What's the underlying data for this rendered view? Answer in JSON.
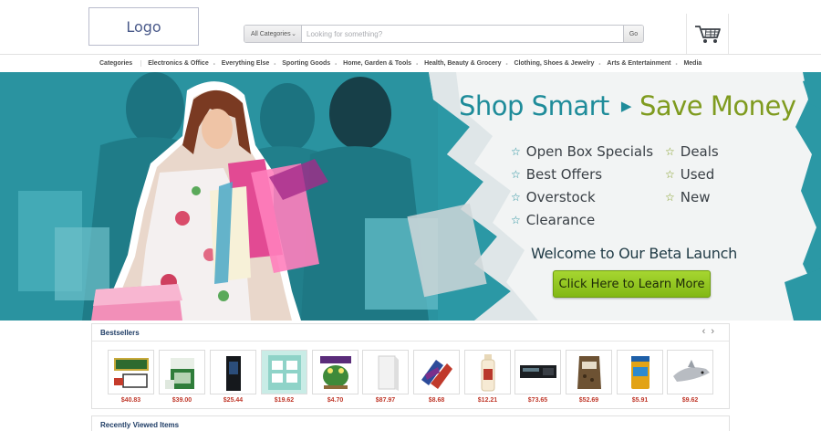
{
  "header": {
    "logo": "Logo",
    "search": {
      "category": "All Categories",
      "placeholder": "Looking for something?",
      "go_label": "Go"
    }
  },
  "nav": {
    "items": [
      "Categories",
      "Electronics & Office",
      "Everything Else",
      "Sporting Goods",
      "Home, Garden & Tools",
      "Health, Beauty & Grocery",
      "Clothing, Shoes & Jewelry",
      "Arts & Entertainment",
      "Media"
    ]
  },
  "banner": {
    "headline_a": "Shop Smart",
    "headline_b": "Save Money",
    "features_left": [
      "Open Box Specials",
      "Best Offers",
      "Overstock",
      "Clearance"
    ],
    "features_right": [
      "Deals",
      "Used",
      "New"
    ],
    "welcome": "Welcome to Our Beta Launch",
    "cta": "Click Here to Learn More"
  },
  "bestsellers": {
    "title": "Bestsellers",
    "prev": "‹",
    "next": "›",
    "products": [
      {
        "price": "$40.83",
        "icon": "aquarium-kit-icon"
      },
      {
        "price": "$39.00",
        "icon": "filter-box-icon"
      },
      {
        "price": "$25.44",
        "icon": "dark-box-icon"
      },
      {
        "price": "$19.62",
        "icon": "photo-kit-icon"
      },
      {
        "price": "$4.70",
        "icon": "frog-ornament-icon"
      },
      {
        "price": "$87.97",
        "icon": "white-box-icon"
      },
      {
        "price": "$8.68",
        "icon": "dog-toy-icon"
      },
      {
        "price": "$12.21",
        "icon": "bottle-icon"
      },
      {
        "price": "$73.65",
        "icon": "light-strip-icon"
      },
      {
        "price": "$52.69",
        "icon": "food-bag-icon"
      },
      {
        "price": "$5.91",
        "icon": "fish-food-can-icon"
      },
      {
        "price": "$9.62",
        "icon": "shark-toy-icon"
      }
    ]
  },
  "recent": {
    "title": "Recently Viewed Items"
  },
  "colors": {
    "teal": "#2b98a5",
    "headline_teal": "#1f8c9a",
    "headline_green": "#7f9b1f",
    "cta_green": "#96c822",
    "price_red": "#c0392b"
  }
}
